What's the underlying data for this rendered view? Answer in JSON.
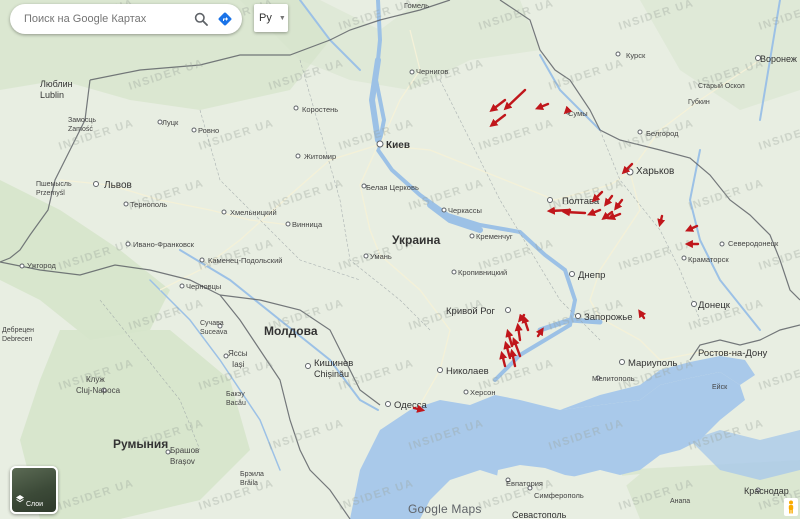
{
  "search": {
    "placeholder": "Поиск на Google Картах"
  },
  "language": {
    "value": "Ру"
  },
  "layers": {
    "label": "Слои"
  },
  "branding": {
    "text": "Google Maps"
  },
  "watermark": {
    "text": "INSIDER UA"
  },
  "colors": {
    "land": "#e8eee2",
    "forest": "#d7e5cc",
    "sea": "#a9c9ea",
    "river": "#9cc1e6",
    "border": "#5f6368",
    "arrow": "#c0161b"
  },
  "labels": {
    "ukraine": "Украина",
    "moldova": "Молдова",
    "romania": "Румыния",
    "kiev": "Киев",
    "lviv": "Львов",
    "kharkov": "Харьков",
    "poltava": "Полтава",
    "dnepr": "Днепр",
    "zaporozhye": "Запорожье",
    "krivoy_rog": "Кривой Рог",
    "nikolaev": "Николаев",
    "odessa": "Одесса",
    "kishinev": "Кишинев",
    "chisinau": "Chișinău",
    "mariupol": "Мариуполь",
    "rostov": "Ростов-на-Дону",
    "donetsk": "Донецк",
    "kramatorsk": "Краматорск",
    "severodonetsk": "Северодонецк",
    "voronezh": "Воронеж",
    "kursk": "Курск",
    "belgorod": "Белгород",
    "sumy": "Сумы",
    "chernigov": "Чернигов",
    "gomel": "Гомель",
    "korosten": "Коростень",
    "zhitomir": "Житомир",
    "belaya_tserkov": "Белая Церковь",
    "cherkassy": "Черкассы",
    "kremenchug": "Кременчуг",
    "kropivnitsky": "Кропивницкий",
    "uman": "Умань",
    "vinnitsa": "Винница",
    "khmelnitsky": "Хмельницкий",
    "kamenets": "Каменец-Подольский",
    "chernovtsy": "Черновцы",
    "ivano": "Ивано-Франковск",
    "ternopol": "Тернополь",
    "lutsk": "Луцк",
    "rovno": "Ровно",
    "uzhgorod": "Ужгород",
    "lublin_ru": "Люблин",
    "lublin": "Lublin",
    "zamosc_ru": "Замосць",
    "zamosc": "Zamość",
    "przemysl_ru": "Пшемысль",
    "przemysl": "Przemyśl",
    "suceava_ru": "Сучава",
    "suceava": "Suceava",
    "iasi_ru": "Яссы",
    "iasi": "Iași",
    "cluj_ru": "Клуж",
    "cluj": "Cluj-Napoca",
    "brasov_ru": "Брашов",
    "brasov": "Brașov",
    "bacau_ru": "Бакэу",
    "bacau": "Bacău",
    "debrecen_ru": "Дебрецен",
    "debrecen": "Debrecen",
    "herson": "Херсон",
    "melitopol": "Мелитополь",
    "evpatoria": "Евпатория",
    "simferopol": "Симферополь",
    "sevastopol": "Севастополь",
    "krasnodar": "Краснодар",
    "stary_oskol": "Старый Оскол",
    "gubkin": "Губкин",
    "yeysk": "Ейск",
    "anapa": "Анапа",
    "brila": "Брэила",
    "brila_lat": "Brăila"
  }
}
